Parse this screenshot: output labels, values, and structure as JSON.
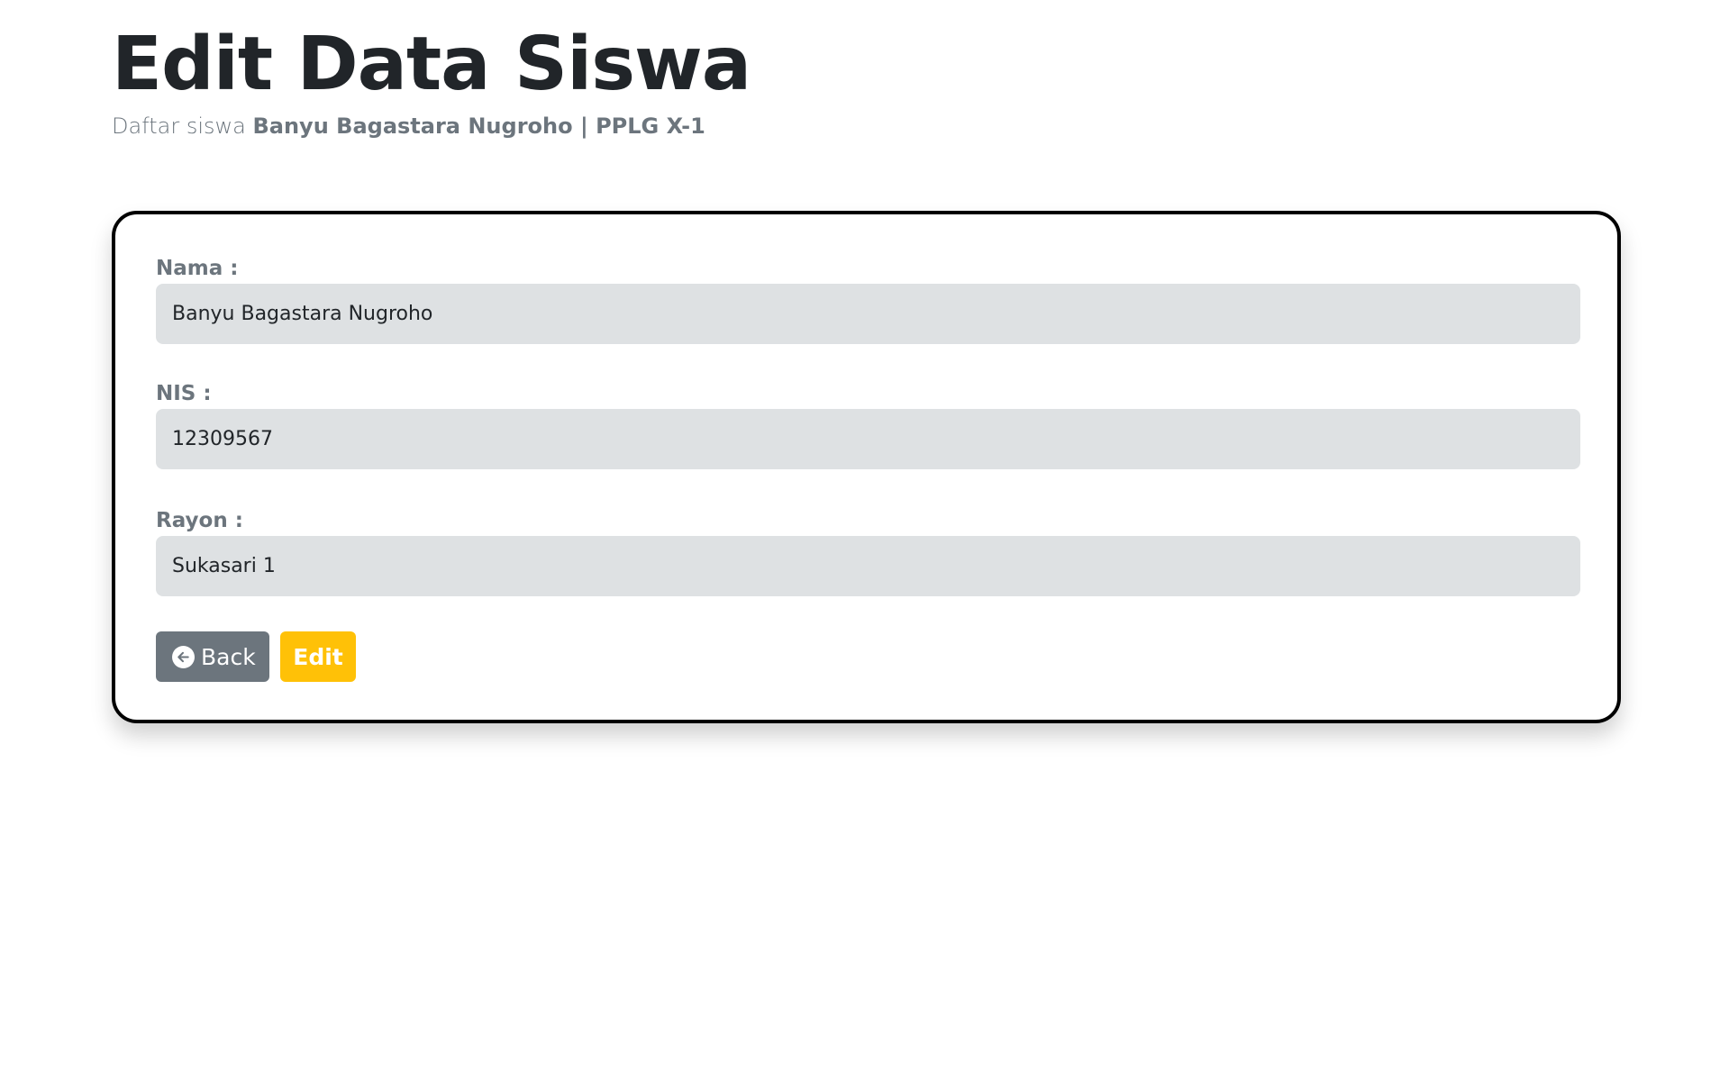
{
  "header": {
    "title": "Edit Data Siswa",
    "subtitle_prefix": "Daftar siswa",
    "subtitle_strong": "Banyu Bagastara Nugroho | PPLG X-1"
  },
  "form": {
    "fields": [
      {
        "label": "Nama :",
        "value": "Banyu Bagastara Nugroho"
      },
      {
        "label": "NIS :",
        "value": "12309567"
      },
      {
        "label": "Rayon :",
        "value": "Sukasari 1"
      }
    ],
    "back_label": "Back",
    "back_icon": "arrow-left-circle-icon",
    "edit_label": "Edit"
  },
  "colors": {
    "title": "#212529",
    "muted": "#6c757d",
    "input_bg": "#dee1e3",
    "back_button": "#6c757d",
    "edit_button": "#ffc107",
    "card_border": "#000000"
  }
}
